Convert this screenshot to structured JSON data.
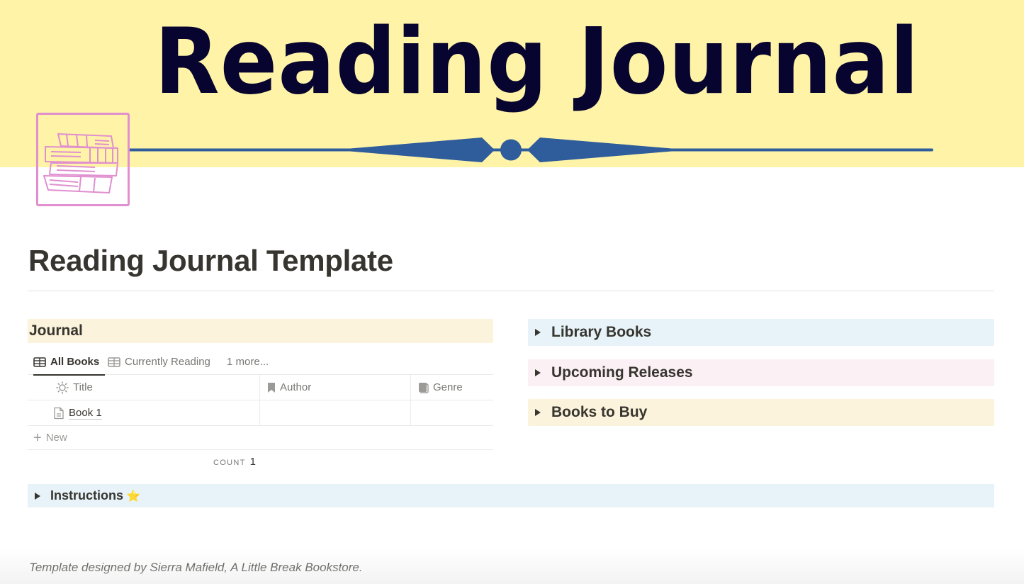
{
  "cover": {
    "title": "Reading Journal",
    "background_color": "#fff3a8",
    "title_color": "#07052f",
    "ornament_color": "#2f5d9b"
  },
  "page_icon": {
    "name": "stack-of-books-icon",
    "border_color": "#e08fcf"
  },
  "page": {
    "title": "Reading Journal Template"
  },
  "journal": {
    "heading": "Journal",
    "heading_bg": "#fbf3db",
    "views": [
      {
        "label": "All Books",
        "icon": "table-icon",
        "active": true
      },
      {
        "label": "Currently Reading",
        "icon": "table-icon",
        "active": false
      },
      {
        "label": "1 more...",
        "icon": "",
        "active": false
      }
    ],
    "columns": [
      {
        "label": "Title",
        "icon": "sun-icon"
      },
      {
        "label": "Author",
        "icon": "bookmark-icon"
      },
      {
        "label": "Genre",
        "icon": "book-icon"
      }
    ],
    "rows": [
      {
        "title": "Book 1",
        "author": "",
        "genre": ""
      }
    ],
    "new_label": "New",
    "count_label": "COUNT",
    "count_value": "1"
  },
  "toggles": [
    {
      "label": "Library Books",
      "bg": "#e7f3f8"
    },
    {
      "label": "Upcoming Releases",
      "bg": "#fbf0f4"
    },
    {
      "label": "Books to Buy",
      "bg": "#fbf3db"
    }
  ],
  "instructions": {
    "label": "Instructions",
    "emoji": "⭐",
    "bg": "#e7f3f8"
  },
  "footer": {
    "note": "Template designed by Sierra Mafield, A Little Break Bookstore."
  }
}
